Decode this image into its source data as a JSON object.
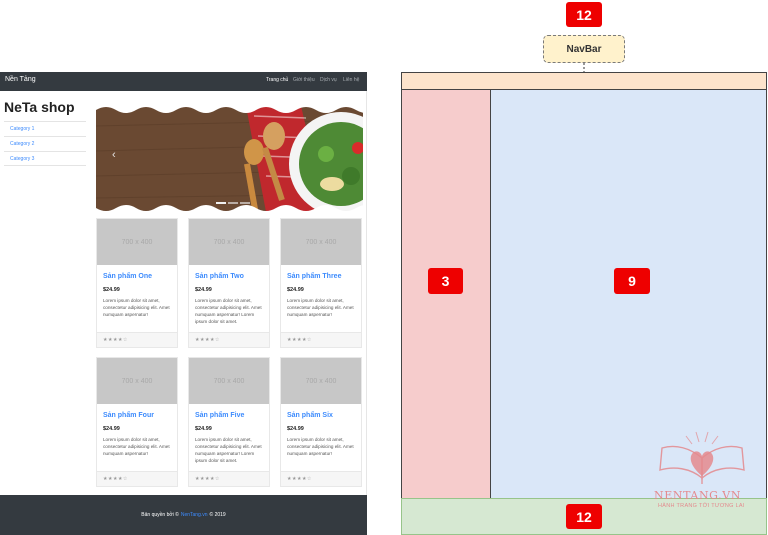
{
  "shop": {
    "nav": {
      "brand": "Nền Tảng",
      "links": [
        "Trang chủ",
        "Giới thiệu",
        "Dịch vụ",
        "Liên hệ"
      ]
    },
    "title": "NeTa shop",
    "categories": [
      "Category 1",
      "Category 2",
      "Category 3"
    ],
    "carousel_prev": "‹",
    "products": [
      {
        "image": "700 x 400",
        "name": "Sản phẩm One",
        "price": "$24.99",
        "desc": "Lorem ipsum dolor sit amet, consectetur adipisicing elit. Amet numquam aspernatur!",
        "rating": "★★★★☆"
      },
      {
        "image": "700 x 400",
        "name": "Sản phẩm Two",
        "price": "$24.99",
        "desc": "Lorem ipsum dolor sit amet, consectetur adipisicing elit. Amet numquam aspernatur! Lorem ipsum dolor sit amet.",
        "rating": "★★★★☆"
      },
      {
        "image": "700 x 400",
        "name": "Sản phẩm Three",
        "price": "$24.99",
        "desc": "Lorem ipsum dolor sit amet, consectetur adipisicing elit. Amet numquam aspernatur!",
        "rating": "★★★★☆"
      },
      {
        "image": "700 x 400",
        "name": "Sản phẩm Four",
        "price": "$24.99",
        "desc": "Lorem ipsum dolor sit amet, consectetur adipisicing elit. Amet numquam aspernatur!",
        "rating": "★★★★☆"
      },
      {
        "image": "700 x 400",
        "name": "Sản phẩm Five",
        "price": "$24.99",
        "desc": "Lorem ipsum dolor sit amet, consectetur adipisicing elit. Amet numquam aspernatur! Lorem ipsum dolor sit amet.",
        "rating": "★★★★☆"
      },
      {
        "image": "700 x 400",
        "name": "Sản phẩm Six",
        "price": "$24.99",
        "desc": "Lorem ipsum dolor sit amet, consectetur adipisicing elit. Amet numquam aspernatur!",
        "rating": "★★★★☆"
      }
    ],
    "footer": {
      "prefix": "Bản quyền bởi ©",
      "link": "NenTang.vn",
      "suffix": "© 2019"
    }
  },
  "diagram": {
    "top_badge": "12",
    "navbar_label": "NavBar",
    "left_col": "3",
    "main_col": "9",
    "footer_badge": "12",
    "badge_color": "#ee0000",
    "colors": {
      "nav": "#fde4cc",
      "left": "#f6cccc",
      "main": "#dae7f8",
      "footer": "#d6e8d2"
    }
  },
  "watermark": {
    "logo_icon": "book-heart-icon",
    "name": "NENTANG.VN",
    "slogan": "HÀNH TRANG TỚI TƯƠNG LAI"
  }
}
